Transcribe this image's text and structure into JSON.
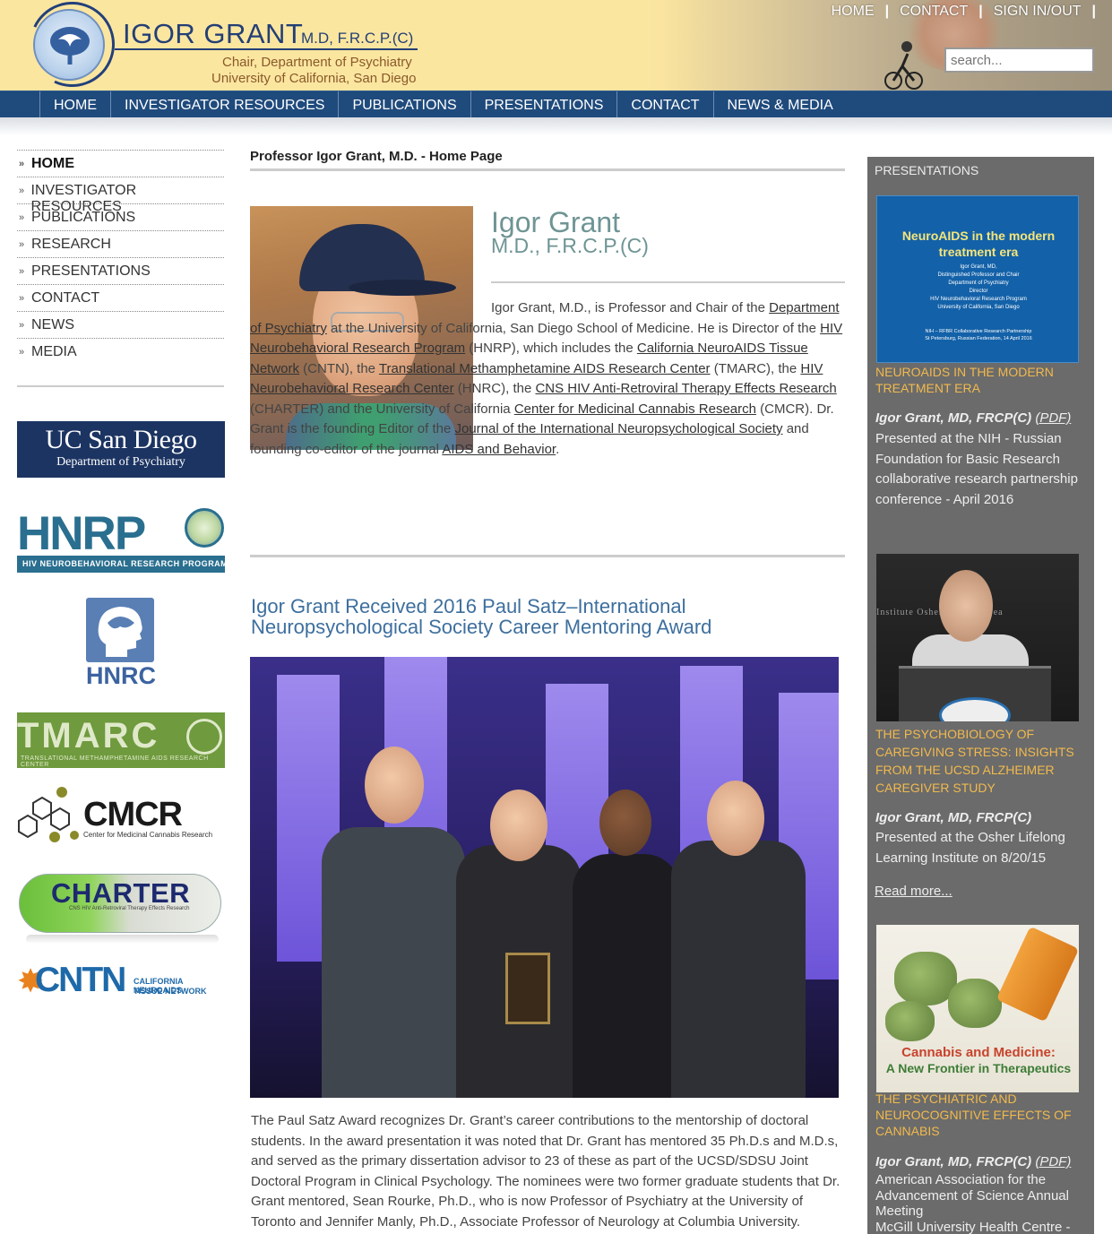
{
  "header": {
    "brand_name": "IGOR GRANT",
    "brand_credentials": "M.D, F.R.C.P.(C)",
    "subtitle_line1": "Chair, Department of Psychiatry",
    "subtitle_line2": "University of California, San Diego",
    "top_links": [
      "HOME",
      "CONTACT",
      "SIGN IN/OUT"
    ],
    "search_placeholder": "search..."
  },
  "nav": {
    "items": [
      "HOME",
      "INVESTIGATOR RESOURCES",
      "PUBLICATIONS",
      "PRESENTATIONS",
      "CONTACT",
      "NEWS & MEDIA"
    ]
  },
  "sidebar": {
    "items": [
      "HOME",
      "INVESTIGATOR RESOURCES",
      "PUBLICATIONS",
      "RESEARCH",
      "PRESENTATIONS",
      "CONTACT",
      "NEWS",
      "MEDIA"
    ],
    "arrow": "»",
    "logos": {
      "ucsd_line1": "UC San Diego",
      "ucsd_line2": "Department of Psychiatry",
      "hnrp_big": "HNRP",
      "hnrp_bar": "HIV NEUROBEHAVIORAL RESEARCH PROGRAM",
      "hnrc": "HNRC",
      "tmarc": "TMARC",
      "tmarc_sub": "TRANSLATIONAL METHAMPHETAMINE AIDS RESEARCH CENTER",
      "cmcr": "CMCR",
      "cmcr_sub": "Center for Medicinal Cannabis Research",
      "charter": "CHARTER",
      "charter_sub": "CNS HIV Anti-Retroviral Therapy Effects Research",
      "cntn": "CNTN",
      "cntn_sub1": "CALIFORNIA NEUROAIDS",
      "cntn_sub2": "TISSUE NETWORK"
    }
  },
  "main": {
    "page_title": "Professor Igor Grant, M.D. - Home Page",
    "name": "Igor Grant",
    "credentials": "M.D., F.R.C.P.(C)",
    "bio": [
      {
        "t": "Igor Grant, M.D., is Professor and Chair of the "
      },
      {
        "t": "Department of Psychiatry",
        "link": true
      },
      {
        "t": " at the University of California, San Diego School of Medicine. He is Director of the "
      },
      {
        "t": "HIV Neurobehavioral Research Program",
        "link": true
      },
      {
        "t": " (HNRP), which includes the "
      },
      {
        "t": "California NeuroAIDS Tissue Network",
        "link": true
      },
      {
        "t": " (CNTN), the "
      },
      {
        "t": "Translational Methamphetamine AIDS Research Center",
        "link": true
      },
      {
        "t": " (TMARC), the "
      },
      {
        "t": "HIV Neurobehavioral Research Center",
        "link": true
      },
      {
        "t": " (HNRC), the "
      },
      {
        "t": "CNS HIV Anti-Retroviral Therapy Effects Research",
        "link": true
      },
      {
        "t": " (CHARTER) and the University of California "
      },
      {
        "t": "Center for Medicinal Cannabis Research",
        "link": true
      },
      {
        "t": " (CMCR). Dr. Grant is the founding Editor of the "
      },
      {
        "t": "Journal of the International Neuropsychological Society",
        "link": true
      },
      {
        "t": " and founding co-editor of the journal "
      },
      {
        "t": "AIDS and Behavior",
        "link": true
      },
      {
        "t": "."
      }
    ],
    "award_heading": "Igor Grant Received 2016 Paul Satz–International Neuropsychological Society Career Mentoring Award",
    "award_text": "The Paul Satz Award recognizes Dr. Grant’s career contributions to the mentorship of doctoral students. In the award presentation it was noted that Dr. Grant has mentored 35 Ph.D.s and M.D.s, and served as the primary dissertation advisor to 23 of these as part of the UCSD/SDSU Joint Doctoral Program in Clinical Psychology.  The nominees were two former graduate students that Dr. Grant mentored, Sean Rourke, Ph.D., who is now Professor of Psychiatry at the University of Toronto and Jennifer Manly, Ph.D., Associate Professor of Neurology at Columbia University."
  },
  "presentations": {
    "heading": "PRESENTATIONS",
    "items": [
      {
        "thumb_title": "NeuroAIDS in the modern treatment era",
        "thumb_lines": "Igor Grant, MD,\nDistinguished Professor and Chair\nDepartment of Psychiatry\nDirector\nHIV Neurobehavioral Research Program\nUniversity of California, San Diego",
        "thumb_footer": "NIH – RFBR Collaborative Research Partnership\nSt Petersburg, Russian Federation, 14 April 2016",
        "title": "NEUROAIDS IN THE MODERN TREATMENT ERA",
        "author": "Igor Grant, MD, FRCP(C)",
        "pdf": "(PDF)",
        "description": "Presented at the NIH - Russian Foundation for Basic Research collaborative research partnership conference - April 2016"
      },
      {
        "thumb_banner": "Institute  Osher Lifelong Lea",
        "title": "THE PSYCHOBIOLOGY OF CAREGIVING STRESS: INSIGHTS FROM THE UCSD ALZHEIMER CAREGIVER STUDY",
        "author": "Igor Grant, MD, FRCP(C)",
        "description": "Presented at the Osher Lifelong Learning Institute on 8/20/15",
        "read_more": "Read more..."
      },
      {
        "thumb_title": "Cannabis and Medicine:",
        "thumb_sub": "A New Frontier in Therapeutics",
        "title": "THE PSYCHIATRIC AND NEUROCOGNITIVE EFFECTS OF CANNABIS",
        "author": "Igor Grant, MD, FRCP(C)",
        "pdf": "(PDF)",
        "description": "American Association for the Advancement of Science Annual Meeting\nMcGill University Health Centre -"
      }
    ]
  },
  "colors": {
    "header_bg": "#fbe6a0",
    "nav_bg": "#1f4a7c",
    "brand_blue": "#233f75",
    "heading_teal": "#6f9494",
    "award_blue": "#3d6f9e",
    "right_panel_bg": "#6b6b6b",
    "presentation_title": "#f1b94d"
  }
}
